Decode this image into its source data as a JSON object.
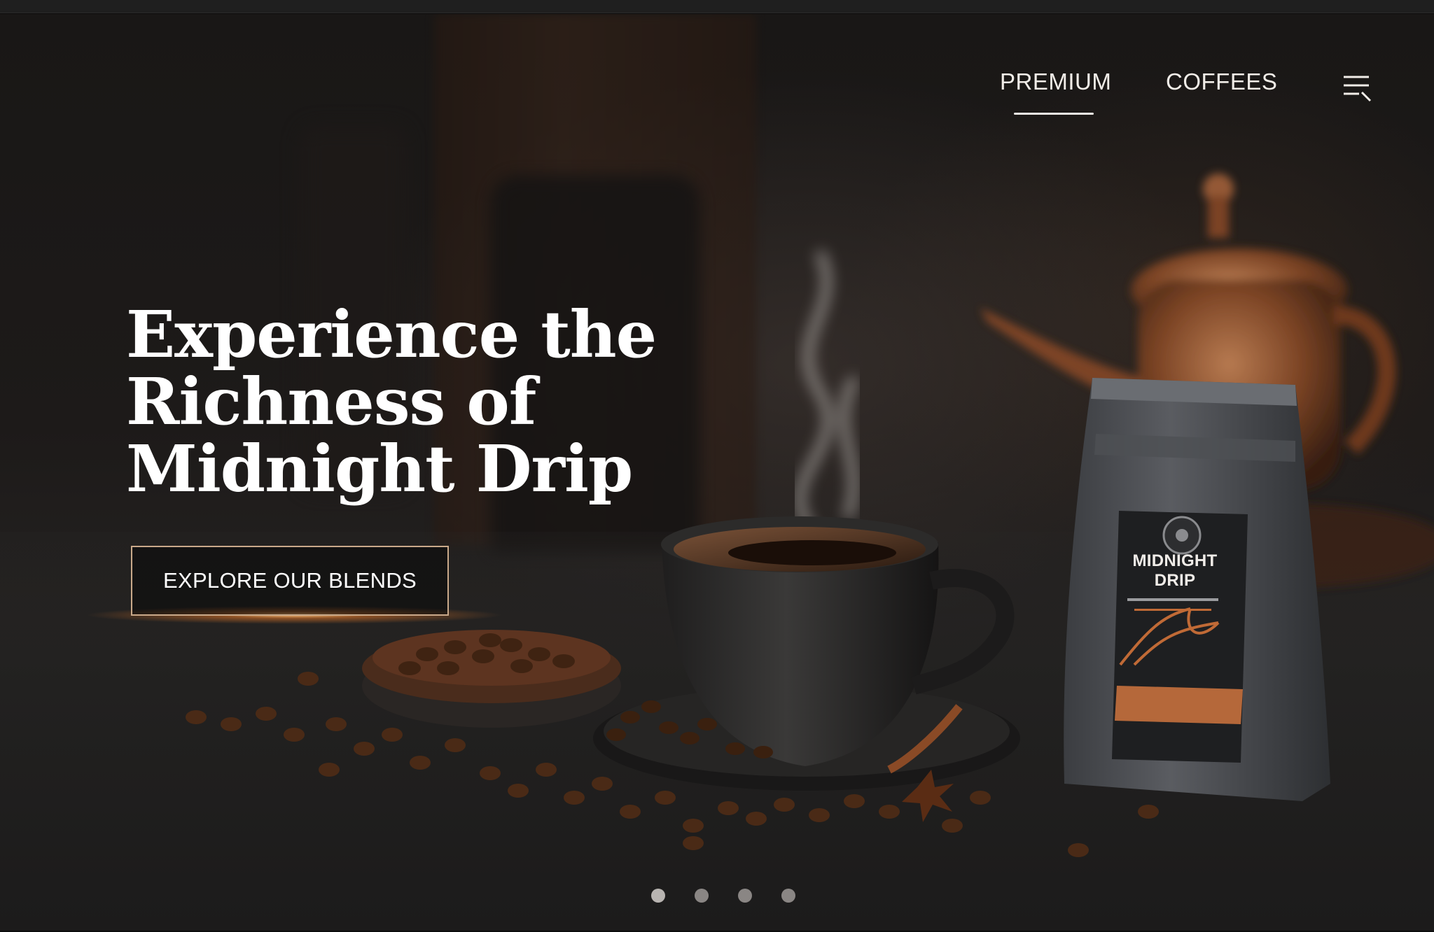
{
  "nav": {
    "links": [
      {
        "label": "PREMIUM",
        "active": true
      },
      {
        "label": "COFFEES",
        "active": false
      }
    ],
    "menu_icon": "menu-search-icon"
  },
  "hero": {
    "headline_lines": [
      "Experience the",
      "Richness of",
      "Midnight Drip"
    ],
    "cta_label": "EXPLORE OUR BLENDS"
  },
  "product": {
    "bag_title": "MIDNIGHT DRIP"
  },
  "carousel": {
    "slide_count": 4,
    "active_index": 0
  },
  "colors": {
    "background": "#1c1a19",
    "text": "#ffffff",
    "accent_copper": "#b5683a",
    "cta_border": "#c9a98a",
    "bag_gray": "#4a4c50"
  }
}
